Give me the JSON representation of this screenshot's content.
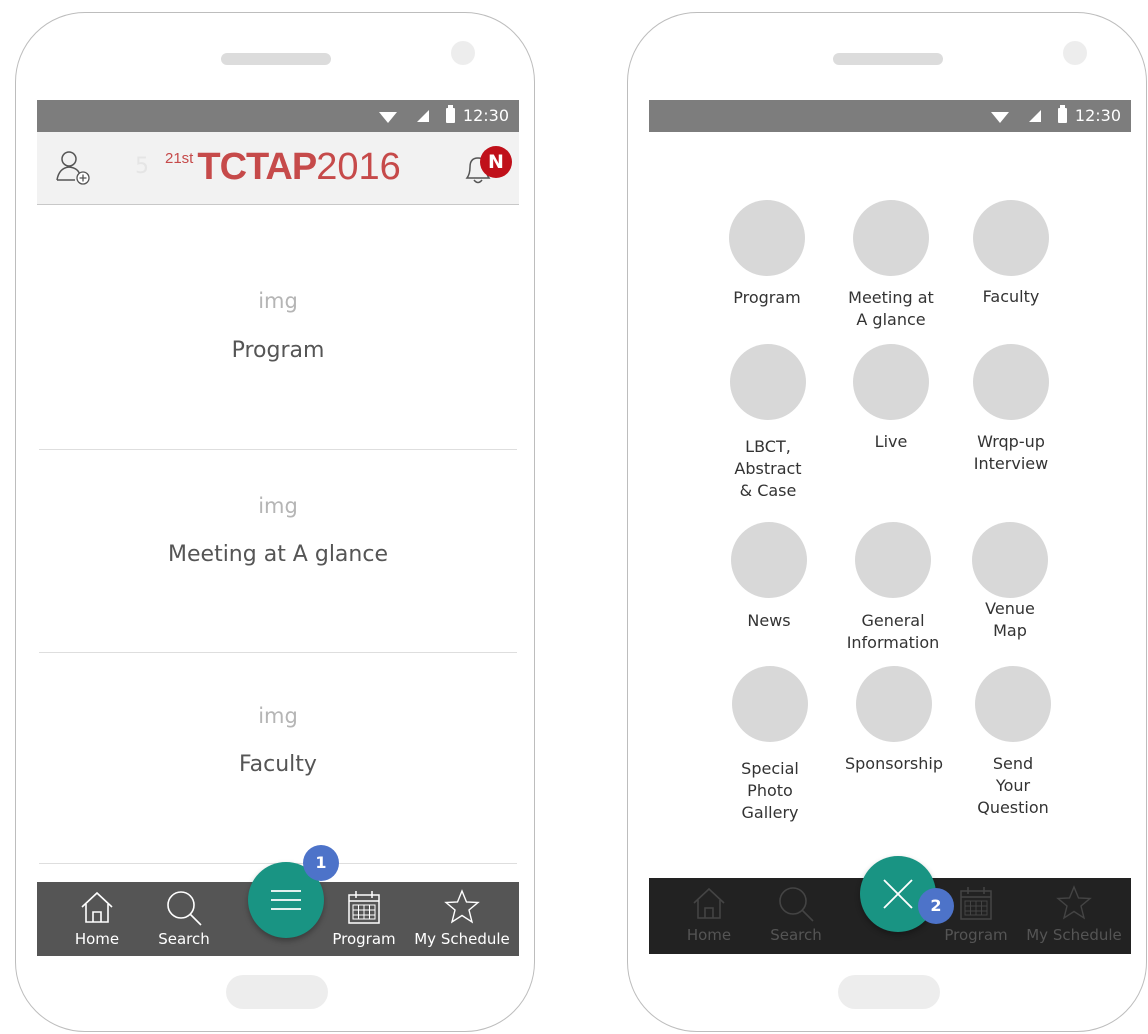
{
  "status_bar": {
    "time": "12:30"
  },
  "left_screen": {
    "header": {
      "logo_faint": "5",
      "logo_ordinal": "21st",
      "logo_main": "TCTAP",
      "logo_year": "2016",
      "notification_badge": "N"
    },
    "cards": [
      {
        "img": "img",
        "label": "Program"
      },
      {
        "img": "img",
        "label": "Meeting at A glance"
      },
      {
        "img": "img",
        "label": "Faculty"
      }
    ],
    "step_badge": "1"
  },
  "bottom_nav": [
    {
      "label": "Home",
      "icon": "home-icon"
    },
    {
      "label": "Search",
      "icon": "search-icon"
    },
    {
      "label": "Program",
      "icon": "calendar-icon"
    },
    {
      "label": "My Schedule",
      "icon": "star-icon"
    }
  ],
  "right_screen": {
    "grid": [
      {
        "label": "Program"
      },
      {
        "label": "Meeting at\nA glance"
      },
      {
        "label": "Faculty"
      },
      {
        "label": "LBCT,\nAbstract\n& Case"
      },
      {
        "label": "Live"
      },
      {
        "label": "Wrqp-up\nInterview"
      },
      {
        "label": "News"
      },
      {
        "label": "General\nInformation"
      },
      {
        "label": "Venue\nMap"
      },
      {
        "label": "Special\nPhoto\nGallery"
      },
      {
        "label": "Sponsorship"
      },
      {
        "label": "Send\nYour\nQuestion"
      }
    ],
    "step_badge": "2"
  },
  "colors": {
    "fab": "#199483",
    "badge_red": "#c0101a",
    "step_badge": "#4d73c9",
    "logo_red": "#c64a4a"
  }
}
